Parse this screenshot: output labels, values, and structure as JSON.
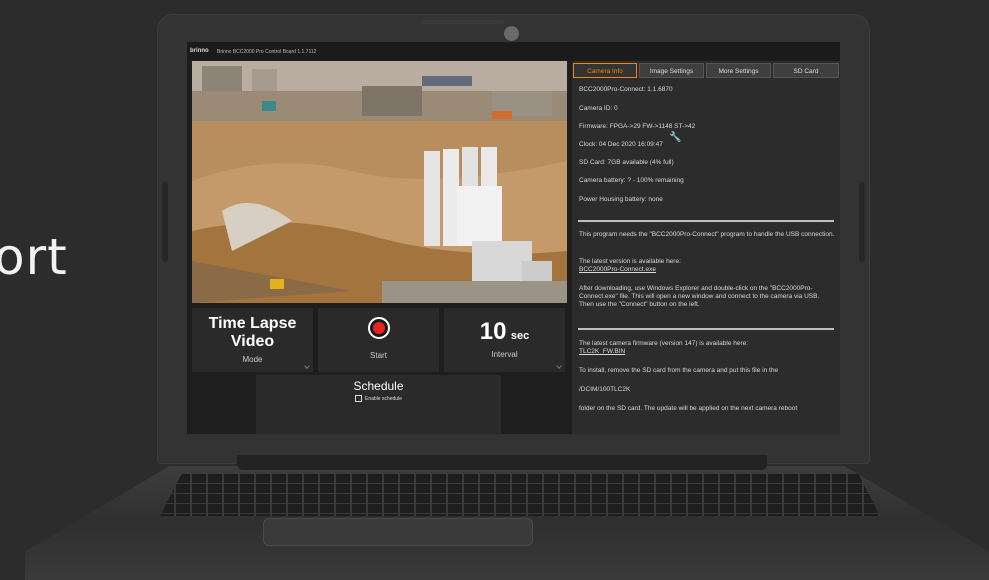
{
  "background": {
    "partial_text": "ort"
  },
  "app": {
    "logo": "brinno",
    "title": "Brinno BCC2000 Pro Control Board 1.1.7112"
  },
  "controls": {
    "mode": {
      "value_line1": "Time Lapse",
      "value_line2": "Video",
      "label": "Mode"
    },
    "start": {
      "label": "Start"
    },
    "interval": {
      "value": "10",
      "unit": "sec",
      "label": "Interval"
    },
    "schedule": {
      "title": "Schedule",
      "checkbox_label": "Enable schedule",
      "checked": false
    }
  },
  "tabs": [
    {
      "label": "Camera Info",
      "active": true
    },
    {
      "label": "Image Settings",
      "active": false
    },
    {
      "label": "More Settings",
      "active": false
    },
    {
      "label": "SD Card",
      "active": false
    }
  ],
  "camera_info": {
    "connect_version": "BCC2000Pro-Connect: 1.1.6870",
    "camera_id": "Camera ID: 0",
    "firmware": "Firmware: FPGA->29 FW->1148 ST->42",
    "clock": "Clock: 04 Dec 2020 16:09:47",
    "sd_card": "SD Card: 7GB available (4% full)",
    "camera_battery": "Camera battery: ? - 100% remaining",
    "power_housing": "Power Housing battery: none"
  },
  "usb_section": {
    "requirement": "This program needs the \"BCC2000Pro-Connect\" program to handle the USB connection.",
    "latest_label": "The latest version is available here:",
    "latest_link": "BCC2000Pro-Connect.exe",
    "instructions": "After downloading, use Windows Explorer and double-click on the \"BCC2000Pro-Connect.exe\" file. This will open a new window and connect to the camera via USB. Then use the \"Connect\" button on the left."
  },
  "firmware_section": {
    "latest_label": "The latest camera firmware (version 147) is available here:",
    "link": "TLC2K_FW.BIN",
    "install": "To install, remove the SD card from the camera and put this file in the",
    "path": "/DCIM/100TLC2K",
    "apply": "folder on the SD card. The update will be applied on the next camera reboot"
  },
  "colors": {
    "accent": "#f0860f",
    "record": "#e62320",
    "panel": "#2c2c2c"
  }
}
